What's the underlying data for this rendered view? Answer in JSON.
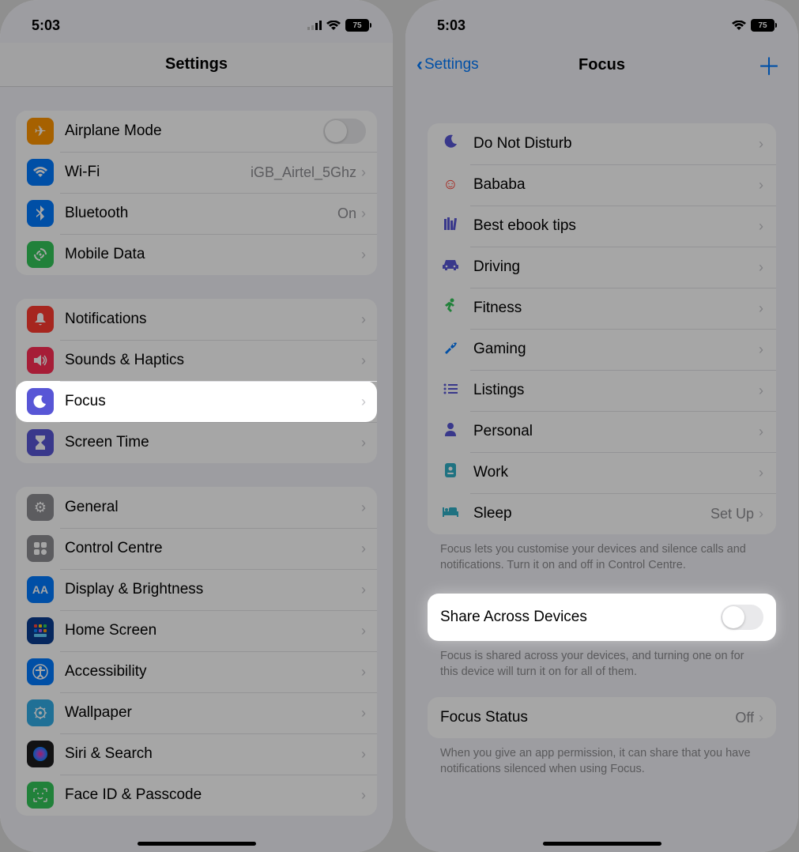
{
  "status": {
    "time": "5:03",
    "battery": "75"
  },
  "left": {
    "title": "Settings",
    "g1": {
      "airplane": "Airplane Mode",
      "wifi_label": "Wi-Fi",
      "wifi_value": "iGB_Airtel_5Ghz",
      "bt_label": "Bluetooth",
      "bt_value": "On",
      "mobile": "Mobile Data"
    },
    "g2": {
      "notifications": "Notifications",
      "sounds": "Sounds & Haptics",
      "focus": "Focus",
      "screentime": "Screen Time"
    },
    "g3": {
      "general": "General",
      "control": "Control Centre",
      "display": "Display & Brightness",
      "home": "Home Screen",
      "accessibility": "Accessibility",
      "wallpaper": "Wallpaper",
      "siri": "Siri & Search",
      "faceid": "Face ID & Passcode"
    }
  },
  "right": {
    "back": "Settings",
    "title": "Focus",
    "items": {
      "dnd": "Do Not Disturb",
      "bababa": "Bababa",
      "ebook": "Best ebook tips",
      "driving": "Driving",
      "fitness": "Fitness",
      "gaming": "Gaming",
      "listings": "Listings",
      "personal": "Personal",
      "work": "Work",
      "sleep": "Sleep",
      "sleep_value": "Set Up"
    },
    "footer1": "Focus lets you customise your devices and silence calls and notifications. Turn it on and off in Control Centre.",
    "share": "Share Across Devices",
    "footer2": "Focus is shared across your devices, and turning one on for this device will turn it on for all of them.",
    "focus_status_label": "Focus Status",
    "focus_status_value": "Off",
    "footer3": "When you give an app permission, it can share that you have notifications silenced when using Focus."
  }
}
